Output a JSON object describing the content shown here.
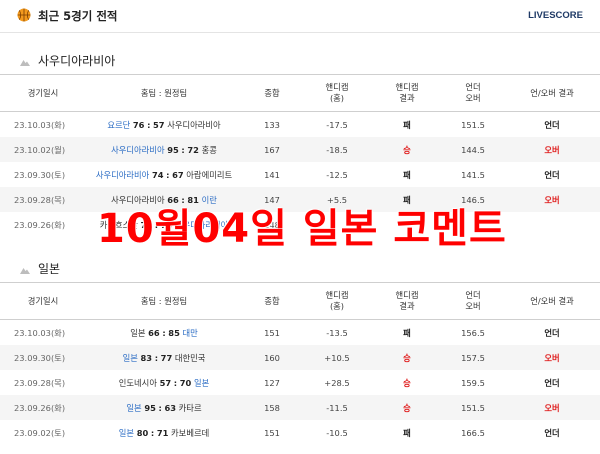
{
  "header": {
    "title": "최근 5경기 전적",
    "brand": "LIVESCORE"
  },
  "columns": [
    "경기일시",
    "홈팀 : 원정팀",
    "종합",
    "핸디캡\n(홈)",
    "핸디캡\n결과",
    "언더\n오버",
    "언/오버 결과"
  ],
  "sections": [
    {
      "title": "사우디아라비아",
      "rows": [
        {
          "date": "23.10.03(화)",
          "home": "요르단",
          "home_score": "76",
          "sep": ":",
          "away_score": "57",
          "away": "사우디아라비아",
          "highlight": "home",
          "total": "133",
          "handicap": "-17.5",
          "handicap_result": "패",
          "ou": "151.5",
          "ou_result": "언더"
        },
        {
          "date": "23.10.02(월)",
          "home": "사우디아라비아",
          "home_score": "95",
          "sep": ":",
          "away_score": "72",
          "away": "홍콩",
          "highlight": "home",
          "total": "167",
          "handicap": "-18.5",
          "handicap_result": "승",
          "ou": "144.5",
          "ou_result": "오버"
        },
        {
          "date": "23.09.30(토)",
          "home": "사우디아라비아",
          "home_score": "74",
          "sep": ":",
          "away_score": "67",
          "away": "아랍에미리트",
          "highlight": "home",
          "total": "141",
          "handicap": "-12.5",
          "handicap_result": "패",
          "ou": "141.5",
          "ou_result": "언더"
        },
        {
          "date": "23.09.28(목)",
          "home": "사우디아라비아",
          "home_score": "66",
          "sep": ":",
          "away_score": "81",
          "away": "이란",
          "highlight": "away",
          "total": "147",
          "handicap": "+5.5",
          "handicap_result": "패",
          "ou": "146.5",
          "ou_result": "오버"
        },
        {
          "date": "23.09.26(화)",
          "home": "카자흐스탄",
          "home_score": "72",
          "sep": ":",
          "away_score": "76",
          "away": "사우디아라비아",
          "highlight": "away",
          "total": "148",
          "handicap": "",
          "handicap_result": "",
          "ou": "",
          "ou_result": ""
        }
      ]
    },
    {
      "title": "일본",
      "rows": [
        {
          "date": "23.10.03(화)",
          "home": "일본",
          "home_score": "66",
          "sep": ":",
          "away_score": "85",
          "away": "대만",
          "highlight": "away",
          "total": "151",
          "handicap": "-13.5",
          "handicap_result": "패",
          "ou": "156.5",
          "ou_result": "언더"
        },
        {
          "date": "23.09.30(토)",
          "home": "일본",
          "home_score": "83",
          "sep": ":",
          "away_score": "77",
          "away": "대한민국",
          "highlight": "home",
          "total": "160",
          "handicap": "+10.5",
          "handicap_result": "승",
          "ou": "157.5",
          "ou_result": "오버"
        },
        {
          "date": "23.09.28(목)",
          "home": "인도네시아",
          "home_score": "57",
          "sep": ":",
          "away_score": "70",
          "away": "일본",
          "highlight": "away",
          "total": "127",
          "handicap": "+28.5",
          "handicap_result": "승",
          "ou": "159.5",
          "ou_result": "언더"
        },
        {
          "date": "23.09.26(화)",
          "home": "일본",
          "home_score": "95",
          "sep": ":",
          "away_score": "63",
          "away": "카타르",
          "highlight": "home",
          "total": "158",
          "handicap": "-11.5",
          "handicap_result": "승",
          "ou": "151.5",
          "ou_result": "오버"
        },
        {
          "date": "23.09.02(토)",
          "home": "일본",
          "home_score": "80",
          "sep": ":",
          "away_score": "71",
          "away": "카보베르데",
          "highlight": "home",
          "total": "151",
          "handicap": "-10.5",
          "handicap_result": "패",
          "ou": "166.5",
          "ou_result": "언더"
        }
      ]
    }
  ],
  "overlay_text": "10월04일 일본 코멘트",
  "colors": {
    "win_lose_red": "#e02020",
    "team_blue": "#2b6cc4",
    "brand_navy": "#1f3a66",
    "overlay_red": "#ff0000",
    "ball_orange": "#f39a1e"
  },
  "icons": {
    "header": "basketball-icon",
    "section": "mountain-icon"
  }
}
